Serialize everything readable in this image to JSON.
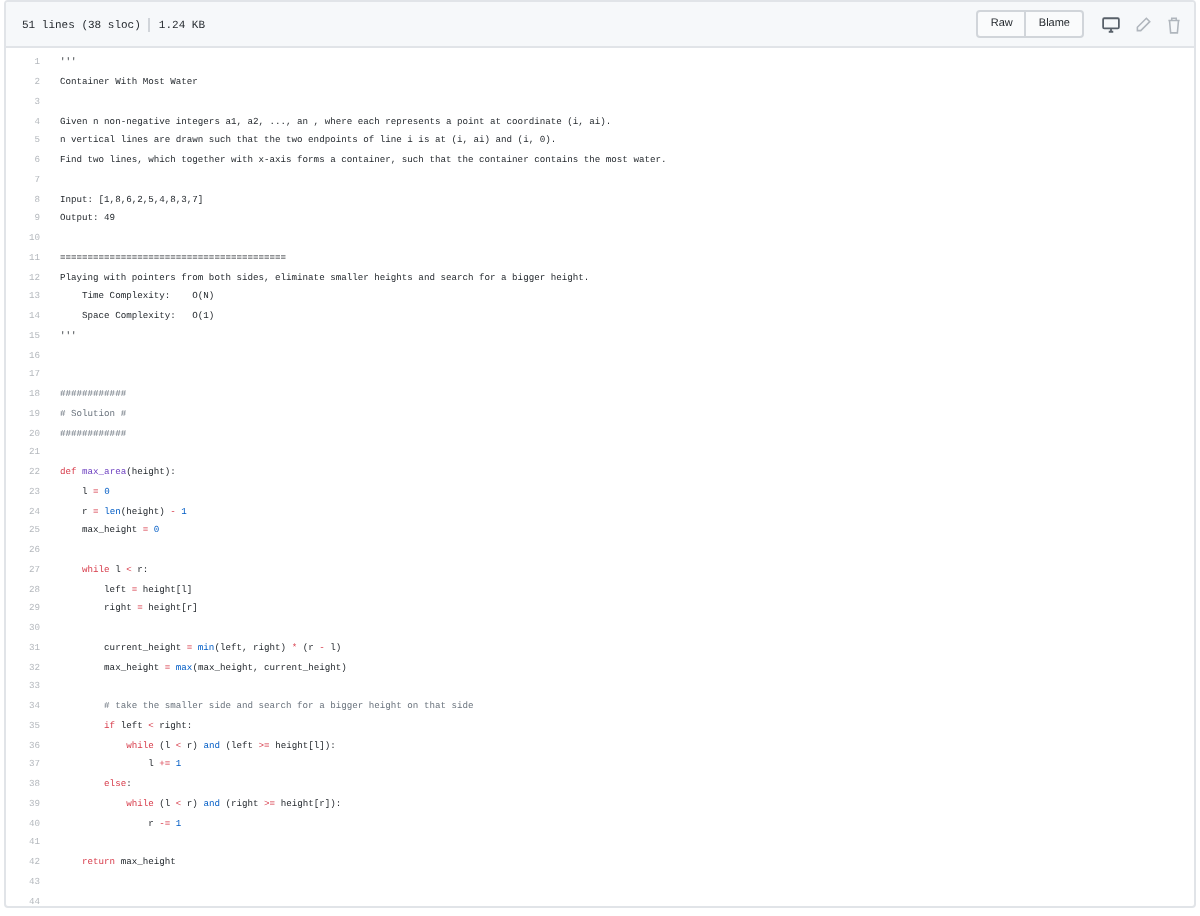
{
  "file_info": {
    "lines": "51 lines (38 sloc)",
    "size": "1.24 KB"
  },
  "actions": [
    {
      "label": "Raw",
      "kind": "text"
    },
    {
      "label": "Blame",
      "kind": "text"
    },
    {
      "kind": "desktop"
    },
    {
      "kind": "pencil"
    },
    {
      "kind": "trash"
    }
  ],
  "code": [
    {
      "number": "1",
      "tokens": [
        {
          "text": "'''",
          "kind": "string"
        }
      ]
    },
    {
      "number": "2",
      "tokens": [
        {
          "text": "Container With Most Water",
          "kind": "string"
        }
      ]
    },
    {
      "number": "3"
    },
    {
      "number": "4",
      "tokens": [
        {
          "text": "Given n non-negative integers a1, a2, ..., an , where each represents a point at coordinate (i, ai).",
          "kind": "string"
        }
      ]
    },
    {
      "number": "5",
      "tokens": [
        {
          "text": "n vertical lines are drawn such that the two endpoints of line i is at (i, ai) and (i, 0).",
          "kind": "string"
        }
      ]
    },
    {
      "number": "6",
      "tokens": [
        {
          "text": "Find two lines, which together with x-axis forms a container, such that the container contains the most water.",
          "kind": "string"
        }
      ]
    },
    {
      "number": "7"
    },
    {
      "number": "8",
      "tokens": [
        {
          "text": "Input: [1,8,6,2,5,4,8,3,7]",
          "kind": "string"
        }
      ]
    },
    {
      "number": "9",
      "tokens": [
        {
          "text": "Output: 49",
          "kind": "string"
        }
      ]
    },
    {
      "number": "10"
    },
    {
      "number": "11",
      "tokens": [
        {
          "text": "=========================================",
          "kind": "string"
        }
      ]
    },
    {
      "number": "12",
      "tokens": [
        {
          "text": "Playing with pointers from both sides, eliminate smaller heights and search for a bigger height.",
          "kind": "string"
        }
      ]
    },
    {
      "number": "13",
      "tokens": [
        {
          "text": "    Time Complexity:    O(N)",
          "kind": "string"
        }
      ]
    },
    {
      "number": "14",
      "tokens": [
        {
          "text": "    Space Complexity:   O(1)",
          "kind": "string"
        }
      ]
    },
    {
      "number": "15",
      "tokens": [
        {
          "text": "'''",
          "kind": "string"
        }
      ]
    },
    {
      "number": "16"
    },
    {
      "number": "17"
    },
    {
      "number": "18",
      "tokens": [
        {
          "text": "############",
          "kind": "comment"
        }
      ]
    },
    {
      "number": "19",
      "tokens": [
        {
          "text": "# Solution #",
          "kind": "comment"
        }
      ]
    },
    {
      "number": "20",
      "tokens": [
        {
          "text": "############",
          "kind": "comment"
        }
      ]
    },
    {
      "number": "21"
    },
    {
      "number": "22",
      "tokens": [
        {
          "text": "def ",
          "kind": "keyword"
        },
        {
          "text": "max_area",
          "kind": "function"
        },
        {
          "text": "(height):",
          "kind": "plain"
        }
      ]
    },
    {
      "number": "23",
      "tokens": [
        {
          "text": "    l ",
          "kind": "plain"
        },
        {
          "text": "= ",
          "kind": "keyword"
        },
        {
          "text": "0",
          "kind": "number"
        }
      ]
    },
    {
      "number": "24",
      "tokens": [
        {
          "text": "    r ",
          "kind": "plain"
        },
        {
          "text": "= ",
          "kind": "keyword"
        },
        {
          "text": "len",
          "kind": "builtin"
        },
        {
          "text": "(height) ",
          "kind": "plain"
        },
        {
          "text": "- ",
          "kind": "keyword"
        },
        {
          "text": "1",
          "kind": "number"
        }
      ]
    },
    {
      "number": "25",
      "tokens": [
        {
          "text": "    max_height ",
          "kind": "plain"
        },
        {
          "text": "= ",
          "kind": "keyword"
        },
        {
          "text": "0",
          "kind": "number"
        }
      ]
    },
    {
      "number": "26"
    },
    {
      "number": "27",
      "tokens": [
        {
          "text": "    while",
          "kind": "keyword"
        },
        {
          "text": " l ",
          "kind": "plain"
        },
        {
          "text": "<",
          "kind": "keyword"
        },
        {
          "text": " r:",
          "kind": "plain"
        }
      ]
    },
    {
      "number": "28",
      "tokens": [
        {
          "text": "        left ",
          "kind": "plain"
        },
        {
          "text": "=",
          "kind": "keyword"
        },
        {
          "text": " height[l]",
          "kind": "plain"
        }
      ]
    },
    {
      "number": "29",
      "tokens": [
        {
          "text": "        right ",
          "kind": "plain"
        },
        {
          "text": "=",
          "kind": "keyword"
        },
        {
          "text": " height[r]",
          "kind": "plain"
        }
      ]
    },
    {
      "number": "30"
    },
    {
      "number": "31",
      "tokens": [
        {
          "text": "        current_height ",
          "kind": "plain"
        },
        {
          "text": "= ",
          "kind": "keyword"
        },
        {
          "text": "min",
          "kind": "builtin"
        },
        {
          "text": "(left, right) ",
          "kind": "plain"
        },
        {
          "text": "*",
          "kind": "keyword"
        },
        {
          "text": " (r ",
          "kind": "plain"
        },
        {
          "text": "-",
          "kind": "keyword"
        },
        {
          "text": " l)",
          "kind": "plain"
        }
      ]
    },
    {
      "number": "32",
      "tokens": [
        {
          "text": "        max_height ",
          "kind": "plain"
        },
        {
          "text": "= ",
          "kind": "keyword"
        },
        {
          "text": "max",
          "kind": "builtin"
        },
        {
          "text": "(max_height, current_height)",
          "kind": "plain"
        }
      ]
    },
    {
      "number": "33"
    },
    {
      "number": "34",
      "tokens": [
        {
          "text": "        # take the smaller side and search for a bigger height on that side",
          "kind": "comment"
        }
      ]
    },
    {
      "number": "35",
      "tokens": [
        {
          "text": "        if",
          "kind": "keyword"
        },
        {
          "text": " left ",
          "kind": "plain"
        },
        {
          "text": "<",
          "kind": "keyword"
        },
        {
          "text": " right:",
          "kind": "plain"
        }
      ]
    },
    {
      "number": "36",
      "tokens": [
        {
          "text": "            while",
          "kind": "keyword"
        },
        {
          "text": " (l ",
          "kind": "plain"
        },
        {
          "text": "<",
          "kind": "keyword"
        },
        {
          "text": " r) ",
          "kind": "plain"
        },
        {
          "text": "and",
          "kind": "builtin"
        },
        {
          "text": " (left ",
          "kind": "plain"
        },
        {
          "text": ">=",
          "kind": "keyword"
        },
        {
          "text": " height[l]):",
          "kind": "plain"
        }
      ]
    },
    {
      "number": "37",
      "tokens": [
        {
          "text": "                l ",
          "kind": "plain"
        },
        {
          "text": "+= ",
          "kind": "keyword"
        },
        {
          "text": "1",
          "kind": "number"
        }
      ]
    },
    {
      "number": "38",
      "tokens": [
        {
          "text": "        else",
          "kind": "keyword"
        },
        {
          "text": ":",
          "kind": "plain"
        }
      ]
    },
    {
      "number": "39",
      "tokens": [
        {
          "text": "            while",
          "kind": "keyword"
        },
        {
          "text": " (l ",
          "kind": "plain"
        },
        {
          "text": "<",
          "kind": "keyword"
        },
        {
          "text": " r) ",
          "kind": "plain"
        },
        {
          "text": "and",
          "kind": "builtin"
        },
        {
          "text": " (right ",
          "kind": "plain"
        },
        {
          "text": ">=",
          "kind": "keyword"
        },
        {
          "text": " height[r]):",
          "kind": "plain"
        }
      ]
    },
    {
      "number": "40",
      "tokens": [
        {
          "text": "                r ",
          "kind": "plain"
        },
        {
          "text": "-= ",
          "kind": "keyword"
        },
        {
          "text": "1",
          "kind": "number"
        }
      ]
    },
    {
      "number": "41"
    },
    {
      "number": "42",
      "tokens": [
        {
          "text": "    return",
          "kind": "keyword"
        },
        {
          "text": " max_height",
          "kind": "plain"
        }
      ]
    },
    {
      "number": "43"
    },
    {
      "number": "44"
    }
  ]
}
